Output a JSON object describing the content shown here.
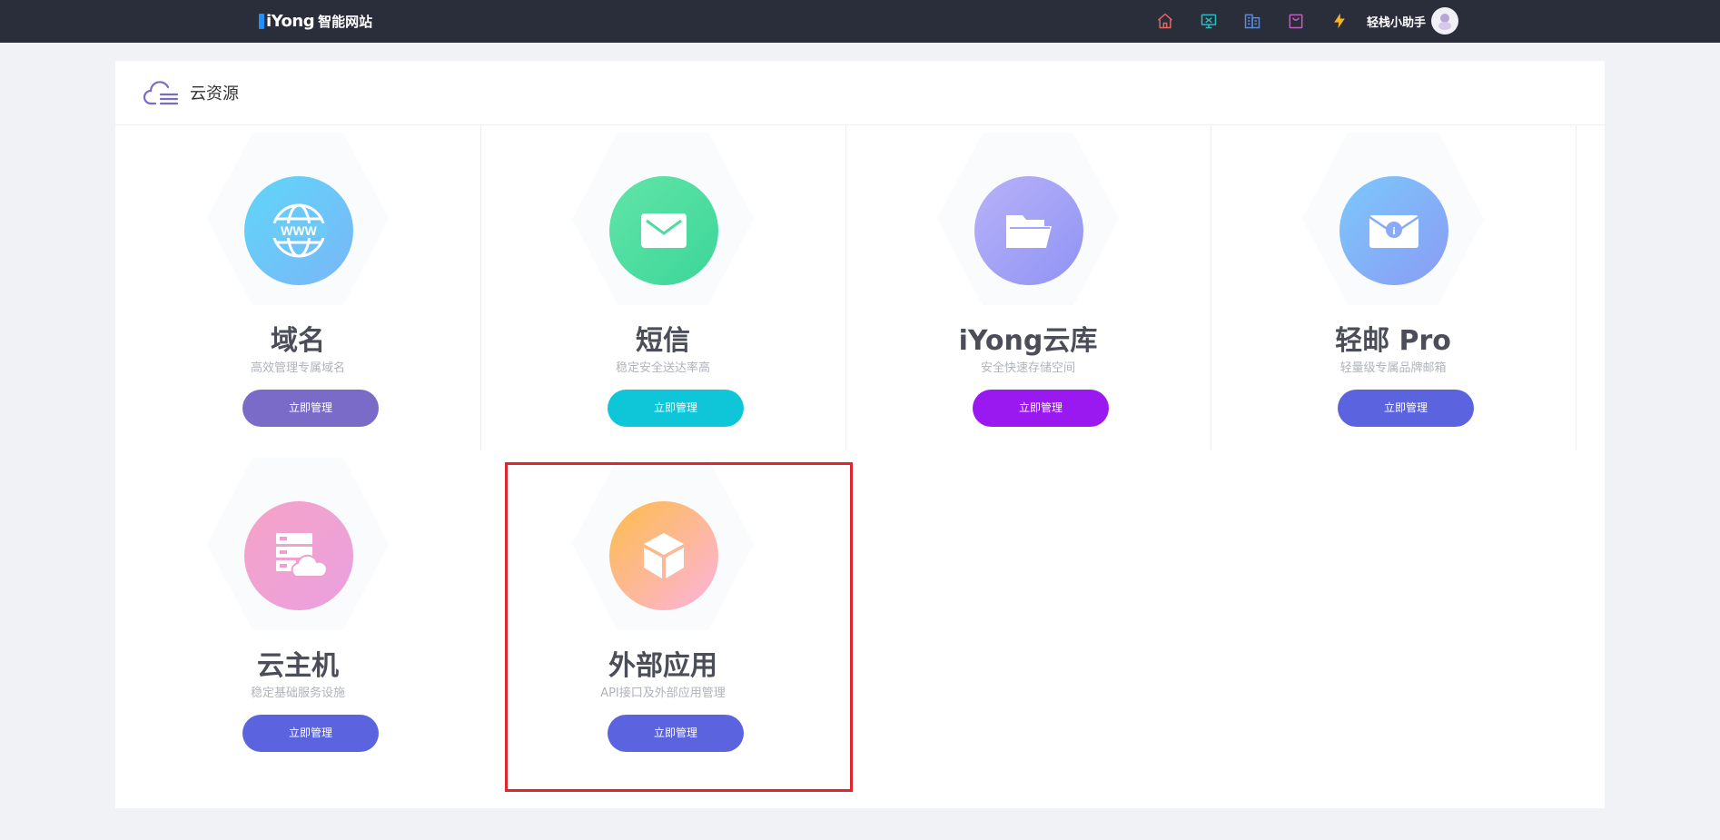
{
  "topbar": {
    "brand": "iYong",
    "brand_sub": "智能网站",
    "icons": [
      {
        "name": "home-icon",
        "color": "#e5675f"
      },
      {
        "name": "monitor-icon",
        "color": "#27bfc2"
      },
      {
        "name": "building-icon",
        "color": "#5a8bd9"
      },
      {
        "name": "bag-icon",
        "color": "#c25fb9"
      },
      {
        "name": "lightning-icon",
        "color": "#f5b22b"
      }
    ],
    "user_name": "轻栈小助手"
  },
  "section": {
    "title": "云资源"
  },
  "cards": [
    {
      "title": "域名",
      "subtitle": "高效管理专属域名",
      "button": "立即管理",
      "button_color": "#7a6bc9",
      "icon": "www-globe-icon"
    },
    {
      "title": "短信",
      "subtitle": "稳定安全送达率高",
      "button": "立即管理",
      "button_color": "#0fc6d8",
      "icon": "envelope-icon"
    },
    {
      "title": "iYong云库",
      "subtitle": "安全快速存储空间",
      "button": "立即管理",
      "button_color": "#9a19f0",
      "icon": "folder-icon"
    },
    {
      "title": "轻邮 Pro",
      "subtitle": "轻量级专属品牌邮箱",
      "button": "立即管理",
      "button_color": "#5b63de",
      "icon": "mail-info-icon"
    },
    {
      "title": "云主机",
      "subtitle": "稳定基础服务设施",
      "button": "立即管理",
      "button_color": "#5b63de",
      "icon": "cloud-server-icon"
    },
    {
      "title": "外部应用",
      "subtitle": "API接口及外部应用管理",
      "button": "立即管理",
      "button_color": "#5b63de",
      "icon": "cube-icon"
    }
  ]
}
